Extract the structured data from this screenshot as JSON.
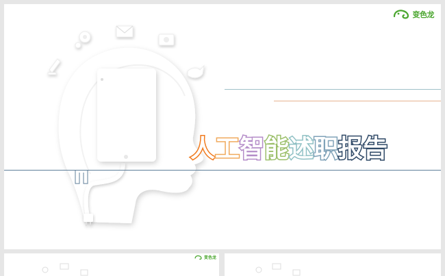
{
  "slide": {
    "logo": {
      "text": "变色龙",
      "icon": "chameleon-icon"
    },
    "title_chars": [
      "人",
      "工",
      "智",
      "能",
      "述",
      "职",
      "报",
      "告"
    ],
    "title_colors": [
      "#f07a1e",
      "#f0a85a",
      "#b48cc8",
      "#9bbf6a",
      "#8fc0c4",
      "#7fa2b8",
      "#2e4866",
      "#2e4866"
    ],
    "icons": [
      "gear-icon",
      "mail-icon",
      "camera-icon",
      "pen-icon",
      "bird-icon",
      "tablet-icon",
      "plug-icon"
    ]
  },
  "thumbnails": [
    {
      "logo_text": "变色龙"
    },
    {
      "logo_text": ""
    }
  ]
}
